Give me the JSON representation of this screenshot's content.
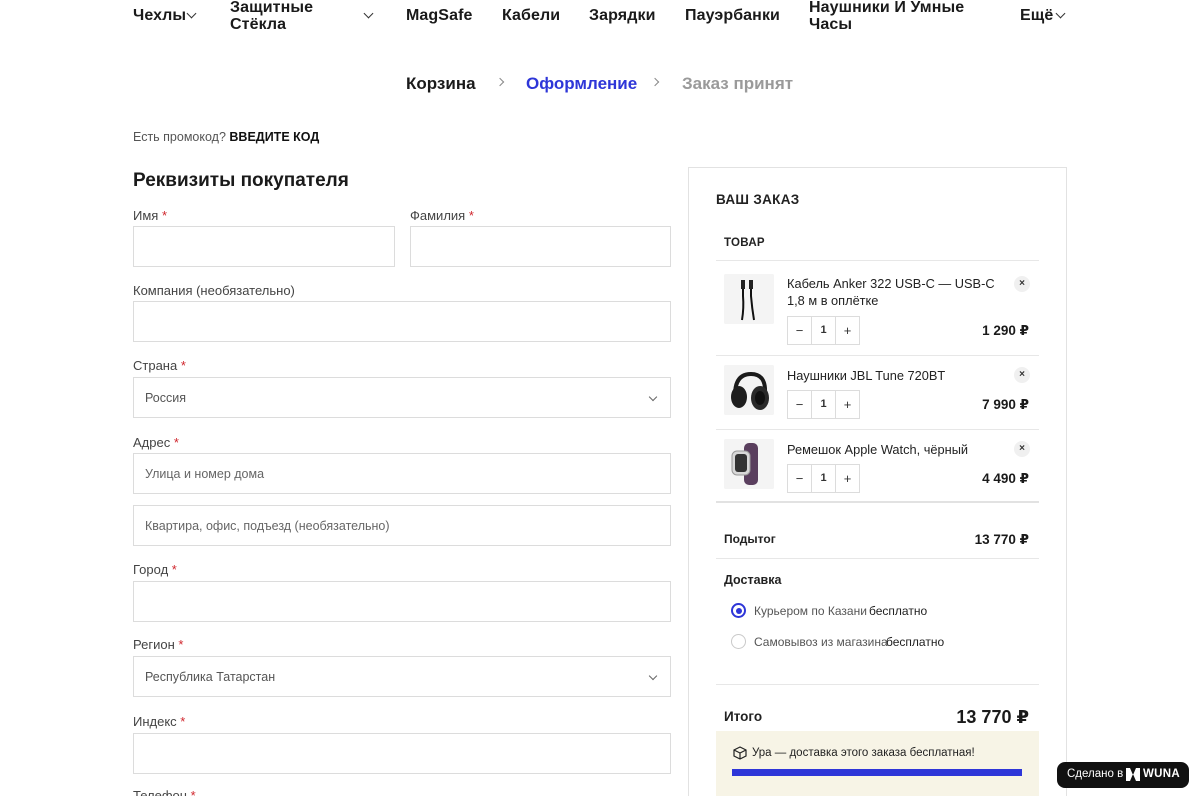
{
  "nav": {
    "items": [
      "Чехлы",
      "Защитные\nСтёкла",
      "MagSafe",
      "Кабели",
      "Зарядки",
      "Пауэрбанки",
      "Наушники И Умные\nЧасы",
      "Ещё"
    ]
  },
  "breadcrumb": {
    "cart": "Корзина",
    "checkout": "Оформление",
    "done": "Заказ принят"
  },
  "promo": {
    "question": "Есть промокод?",
    "link": "ВВЕДИТЕ КОД"
  },
  "billing": {
    "title": "Реквизиты покупателя",
    "first_name_label": "Имя",
    "last_name_label": "Фамилия",
    "company_label": "Компания (необязательно)",
    "country_label": "Страна",
    "country_value": "Россия",
    "address_label": "Адрес",
    "address1_placeholder": "Улица и номер дома",
    "address2_placeholder": "Квартира, офис, подъезд (необязательно)",
    "city_label": "Город",
    "region_label": "Регион",
    "region_value": "Республика Татарстан",
    "zip_label": "Индекс",
    "phone_label": "Телефон",
    "required_mark": "*"
  },
  "order": {
    "title": "ВАШ ЗАКАЗ",
    "product_header": "ТОВАР",
    "items": [
      {
        "name": "Кабель Anker 322 USB-C — USB-C 1,8 м в оплётке",
        "qty": "1",
        "price": "1 290 ₽"
      },
      {
        "name": "Наушники JBL Tune 720BT",
        "qty": "1",
        "price": "7 990 ₽"
      },
      {
        "name": "Ремешок Apple Watch, чёрный",
        "qty": "1",
        "price": "4 490 ₽"
      }
    ],
    "remove_symbol": "×",
    "minus_symbol": "−",
    "plus_symbol": "+",
    "subtotal_label": "Подытог",
    "subtotal_value": "13 770 ₽",
    "shipping_label": "Доставка",
    "shipping_options": [
      {
        "label": "Курьером по Казани",
        "price": "бесплатно",
        "selected": true
      },
      {
        "label": "Самовывоз из магазина",
        "price": "бесплатно",
        "selected": false
      }
    ],
    "total_label": "Итого",
    "total_value": "13 770 ₽",
    "free_shipping_notice": "Ура — доставка этого заказа бесплатная!",
    "free_shipping_progress": 1.0
  },
  "badge": {
    "made_in": "Сделано в",
    "brand": "WUNA"
  },
  "colors": {
    "accent": "#2e36d8",
    "required": "#d0262d",
    "notice_bg": "#f7f4e6"
  }
}
